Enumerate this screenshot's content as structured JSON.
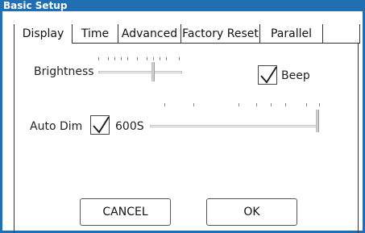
{
  "window": {
    "title": "Basic Setup",
    "accent_color": "#1f6fb2"
  },
  "tabs": [
    {
      "label": "Display",
      "active": true
    },
    {
      "label": "Time",
      "active": false
    },
    {
      "label": "Advanced",
      "active": false
    },
    {
      "label": "Factory Reset",
      "active": false
    },
    {
      "label": "Parallel",
      "active": false
    }
  ],
  "display": {
    "brightness": {
      "label": "Brightness",
      "value_fraction": 0.67
    },
    "beep": {
      "label": "Beep",
      "checked": true
    },
    "auto_dim": {
      "label": "Auto Dim",
      "checked": true,
      "value_text": "600S",
      "value_fraction": 1.0
    }
  },
  "buttons": {
    "cancel": "CANCEL",
    "ok": "OK"
  }
}
